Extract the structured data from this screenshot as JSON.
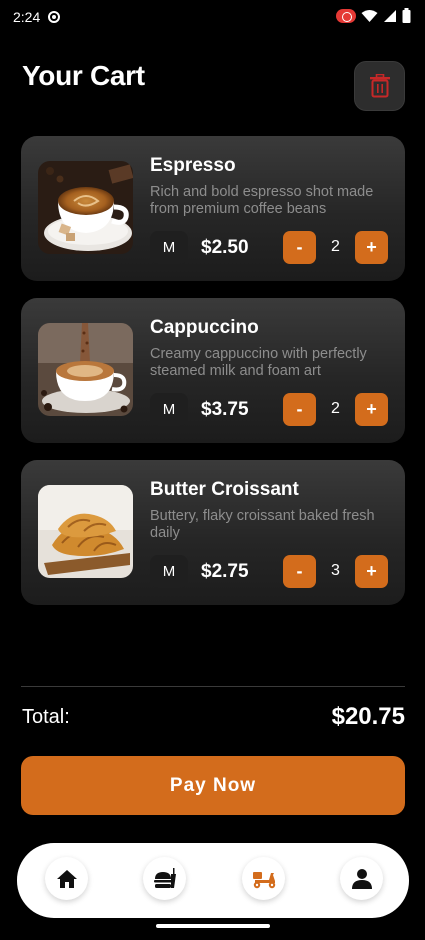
{
  "status_bar": {
    "time": "2:24"
  },
  "header": {
    "title": "Your Cart"
  },
  "cart": {
    "items": [
      {
        "name": "Espresso",
        "description": "Rich and bold espresso shot made from premium coffee beans",
        "size": "M",
        "price": "$2.50",
        "quantity": "2",
        "minus": "-",
        "plus": "+"
      },
      {
        "name": "Cappuccino",
        "description": "Creamy cappuccino with perfectly steamed milk and foam art",
        "size": "M",
        "price": "$3.75",
        "quantity": "2",
        "minus": "-",
        "plus": "+"
      },
      {
        "name": "Butter Croissant",
        "description": "Buttery, flaky croissant baked fresh daily",
        "size": "M",
        "price": "$2.75",
        "quantity": "3",
        "minus": "-",
        "plus": "+"
      }
    ]
  },
  "summary": {
    "total_label": "Total:",
    "total_value": "$20.75"
  },
  "actions": {
    "pay_label": "Pay Now"
  },
  "nav": {
    "items": [
      "home-icon",
      "food-icon",
      "delivery-scooter-icon",
      "profile-icon"
    ],
    "active_color": "#d36c1c"
  },
  "colors": {
    "accent": "#d36c1c",
    "trash": "#c62828",
    "background": "#000000"
  }
}
